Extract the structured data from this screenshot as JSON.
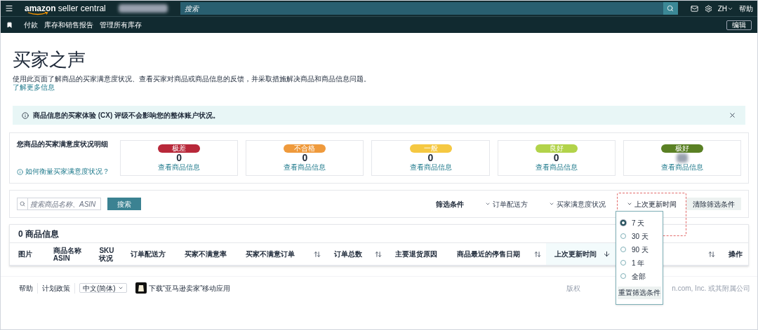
{
  "top_bar": {
    "logo": {
      "brand": "amazon",
      "product": "seller central"
    },
    "search": {
      "placeholder": "搜索"
    },
    "language": "ZH",
    "help": "帮助"
  },
  "nav_bar": {
    "items": [
      "付款",
      "库存和销售报告",
      "管理所有库存"
    ],
    "edit": "编辑"
  },
  "page": {
    "title": "买家之声",
    "description": "使用此页面了解商品的买家满意度状况、查看买家对商品或商品信息的反馈，并采取措施解决商品和商品信息问题。",
    "learn_more": "了解更多信息"
  },
  "alert": {
    "text": "商品信息的买家体验 (CX) 评级不会影响您的整体账户状况。"
  },
  "ratings": {
    "heading": "您商品的买家满意度状况明细",
    "help_link": "如何衡量买家满意度状况？",
    "cards": [
      {
        "label": "极差",
        "color": "#b8283a",
        "count": "0",
        "blurred": false,
        "link": "查看商品信息"
      },
      {
        "label": "不合格",
        "color": "#ef9a3c",
        "count": "0",
        "blurred": false,
        "link": "查看商品信息"
      },
      {
        "label": "一般",
        "color": "#f5c842",
        "count": "0",
        "blurred": false,
        "link": "查看商品信息"
      },
      {
        "label": "良好",
        "color": "#b2d34a",
        "count": "0",
        "blurred": false,
        "link": "查看商品信息"
      },
      {
        "label": "极好",
        "color": "#5a8024",
        "blurred": true,
        "link": "查看商品信息"
      }
    ]
  },
  "filters": {
    "search": {
      "placeholder": "搜索商品名称、ASIN"
    },
    "search_button": "搜索",
    "label": "筛选条件",
    "dropdowns": [
      {
        "label": "订单配送方",
        "open": false
      },
      {
        "label": "买家满意度状况",
        "open": false
      },
      {
        "label": "上次更新时间",
        "open": true
      }
    ],
    "clear": "清除筛选条件",
    "popover": {
      "options": [
        {
          "label": "7 天",
          "selected": true
        },
        {
          "label": "30 天",
          "selected": false
        },
        {
          "label": "90 天",
          "selected": false
        },
        {
          "label": "1 年",
          "selected": false
        },
        {
          "label": "全部",
          "selected": false
        }
      ],
      "reset": "重置筛选条件"
    }
  },
  "table": {
    "title": "0 商品信息",
    "columns": [
      {
        "lines": [
          "图片"
        ],
        "kind": "plain",
        "highlighted": false
      },
      {
        "lines": [
          "商品名称",
          "ASIN"
        ],
        "kind": "plain",
        "highlighted": false
      },
      {
        "lines": [
          "SKU",
          "状况"
        ],
        "kind": "plain",
        "highlighted": false
      },
      {
        "lines": [
          "订单配送方"
        ],
        "kind": "plain",
        "highlighted": false
      },
      {
        "lines": [
          "买家不满意率"
        ],
        "kind": "plain",
        "highlighted": false
      },
      {
        "lines": [
          "买家不满意订单"
        ],
        "kind": "sortable",
        "highlighted": false
      },
      {
        "lines": [
          "订单总数"
        ],
        "kind": "sortable",
        "highlighted": false
      },
      {
        "lines": [
          "主要退货原因"
        ],
        "kind": "plain",
        "highlighted": false
      },
      {
        "lines": [
          "商品最近的停售日期"
        ],
        "kind": "sortable",
        "highlighted": false
      },
      {
        "lines": [
          "上次更新时间"
        ],
        "kind": "sorted",
        "highlighted": true
      },
      {
        "kind": "sortable",
        "highlighted": false
      },
      {
        "lines": [
          "操作"
        ],
        "kind": "plain",
        "highlighted": false
      }
    ]
  },
  "footer": {
    "links": [
      "帮助",
      "计划政策"
    ],
    "language": "中文(简体)",
    "app_link": "下载“亚马逊卖家”移动应用",
    "copyright_start": "版权",
    "copyright_end": "n.com, Inc. 或其附属公司"
  }
}
